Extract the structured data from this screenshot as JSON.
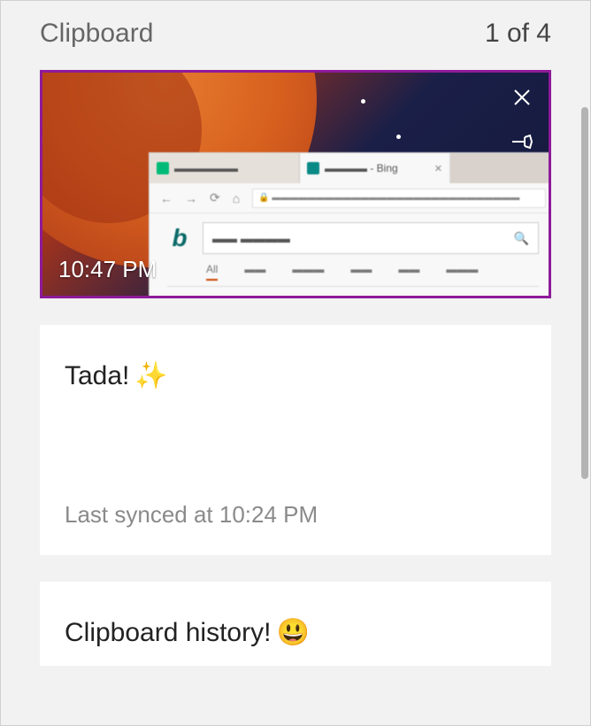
{
  "header": {
    "title": "Clipboard",
    "position": "1 of 4"
  },
  "items": [
    {
      "kind": "screenshot",
      "timestamp": "10:47 PM",
      "selected": true
    },
    {
      "kind": "text",
      "text": "Tada!",
      "emoji": "✨",
      "sync_status": "Last synced at 10:24 PM"
    },
    {
      "kind": "text",
      "text": "Clipboard history!",
      "emoji": "😃"
    }
  ],
  "icons": {
    "close": "close-icon",
    "pin": "pin-icon"
  }
}
